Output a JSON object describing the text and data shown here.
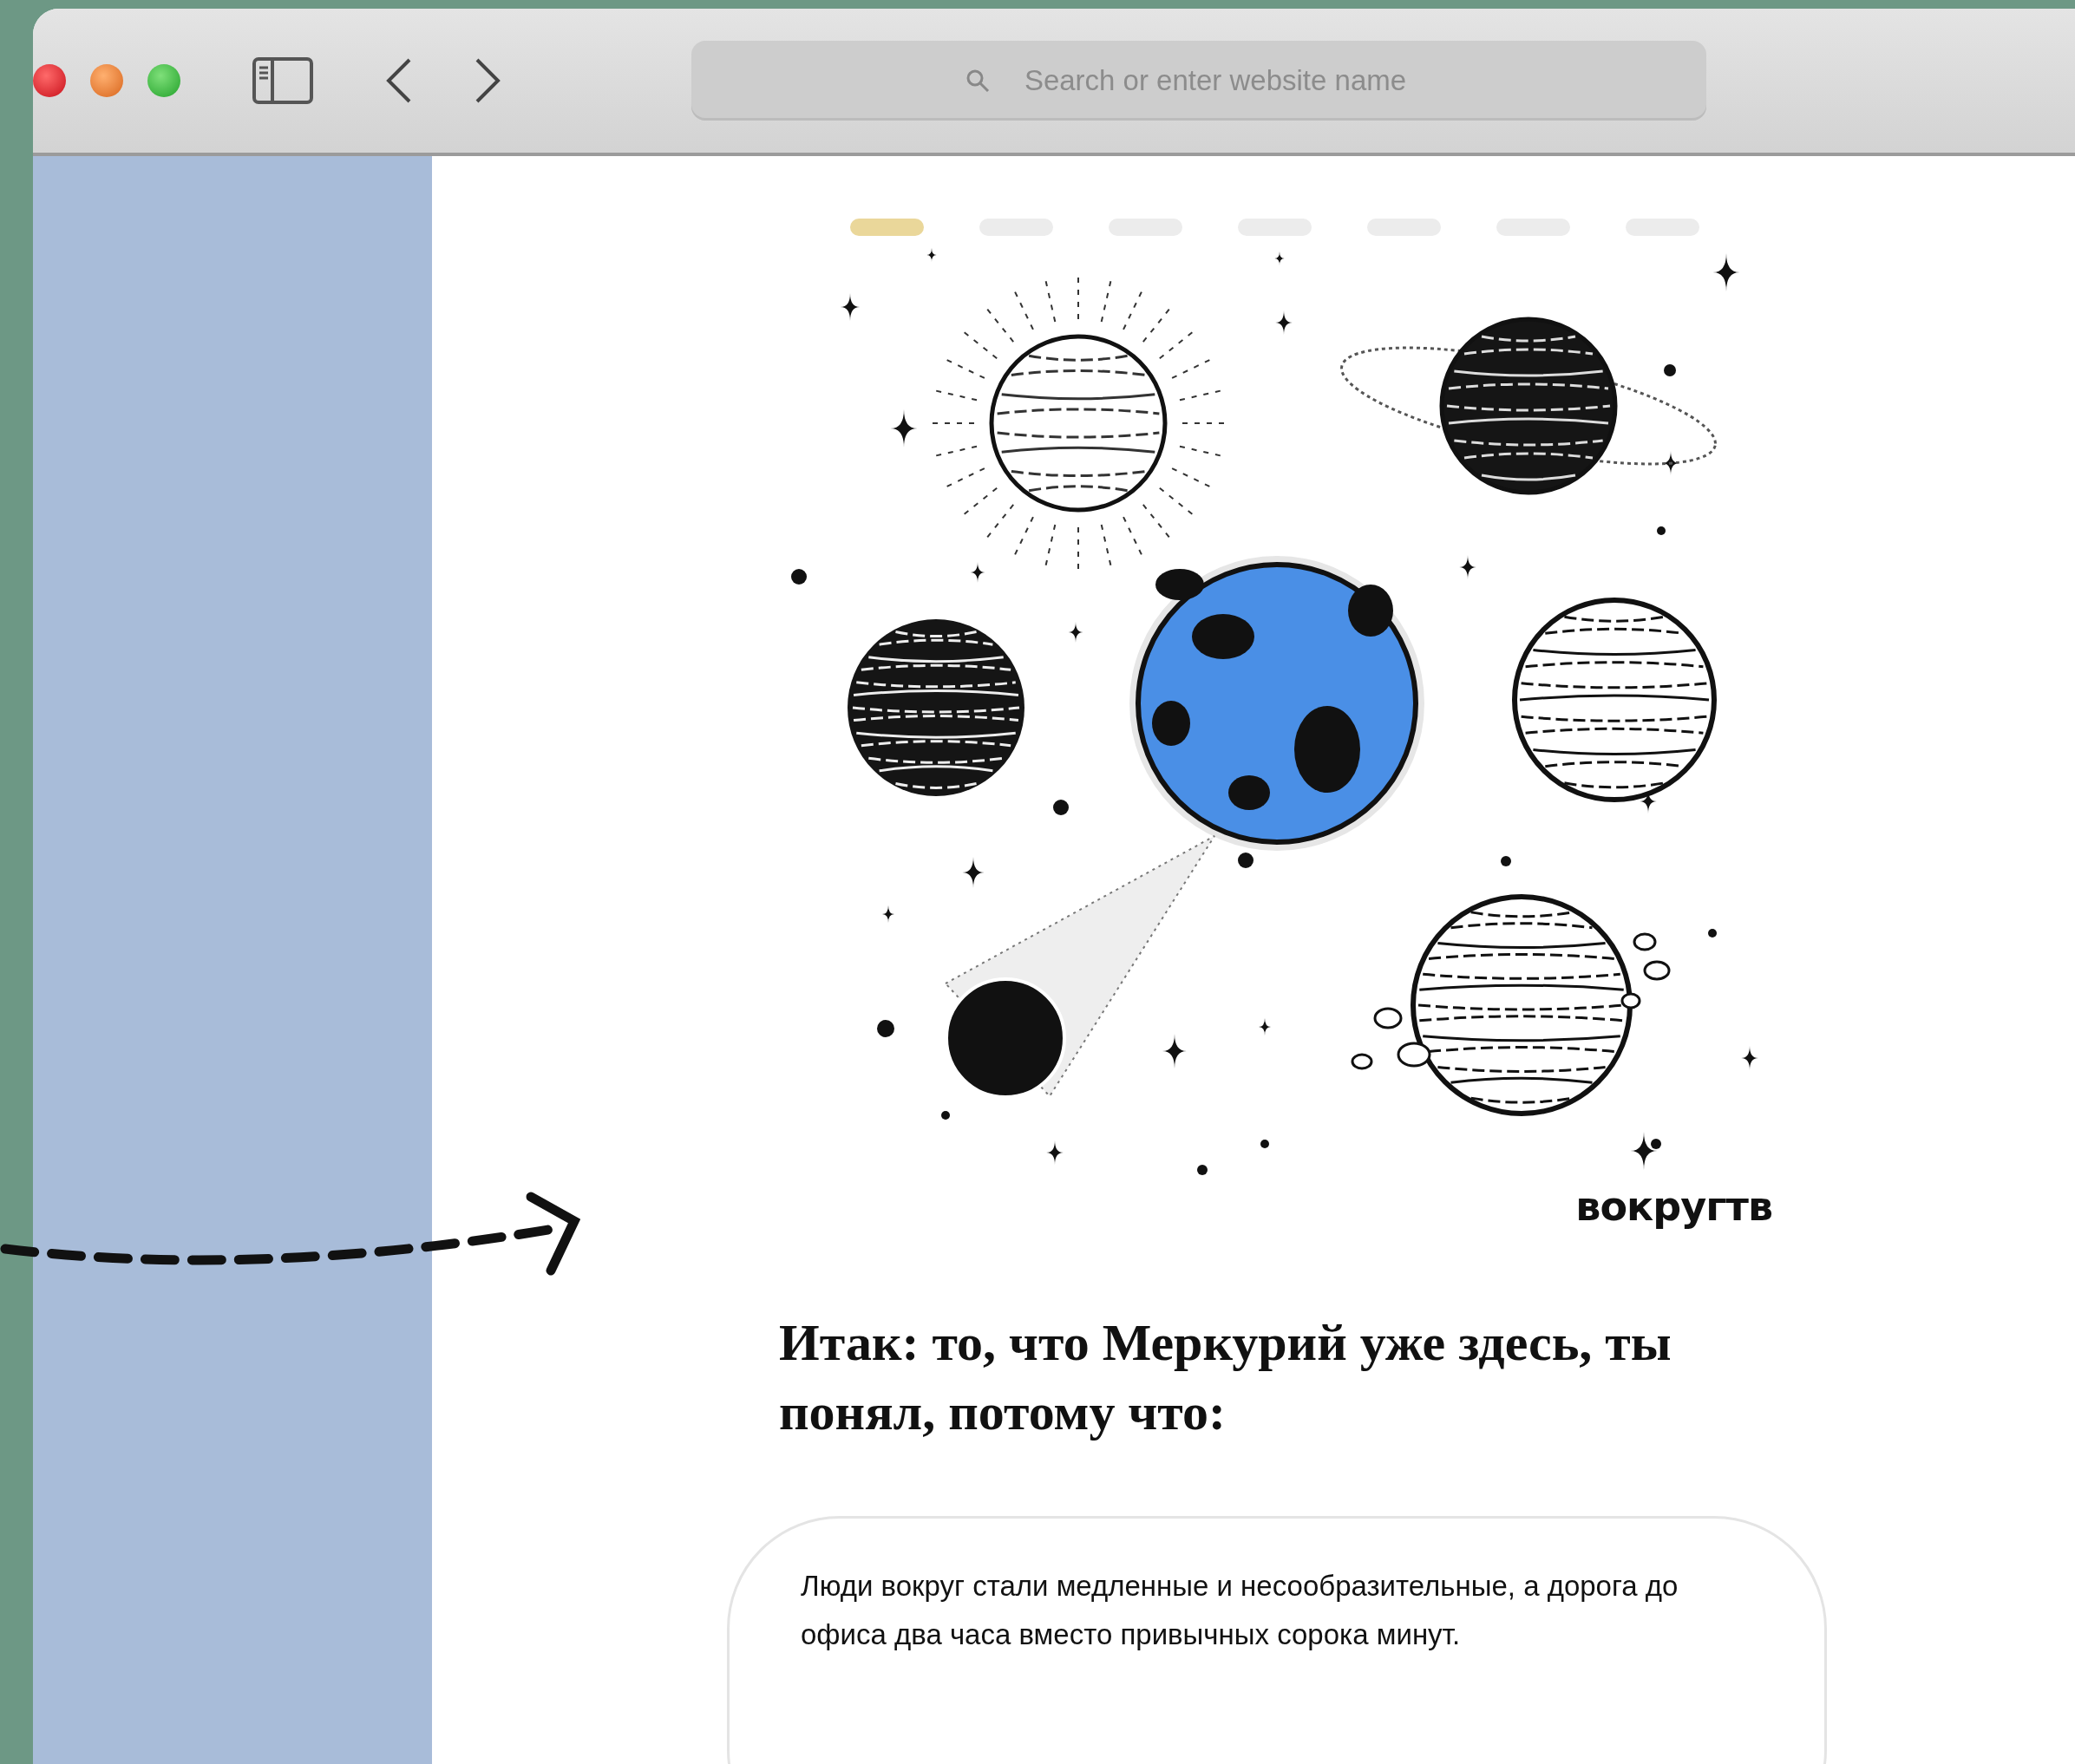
{
  "window": {
    "address_bar": {
      "placeholder": "Search or enter website name"
    }
  },
  "progress_steps": [
    {
      "selected": true
    },
    {
      "selected": false
    },
    {
      "selected": false
    },
    {
      "selected": false
    },
    {
      "selected": false
    },
    {
      "selected": false
    },
    {
      "selected": false
    }
  ],
  "illustration": {
    "credit_logo": "вокругтв"
  },
  "question": {
    "title": "Итак: то, что Меркурий уже здесь, ты понял, потому что:"
  },
  "answers": [
    {
      "text": "Люди вокруг стали медленные и несообразительные, а дорога до офиса два часа вместо привычных сорока минут."
    }
  ]
}
